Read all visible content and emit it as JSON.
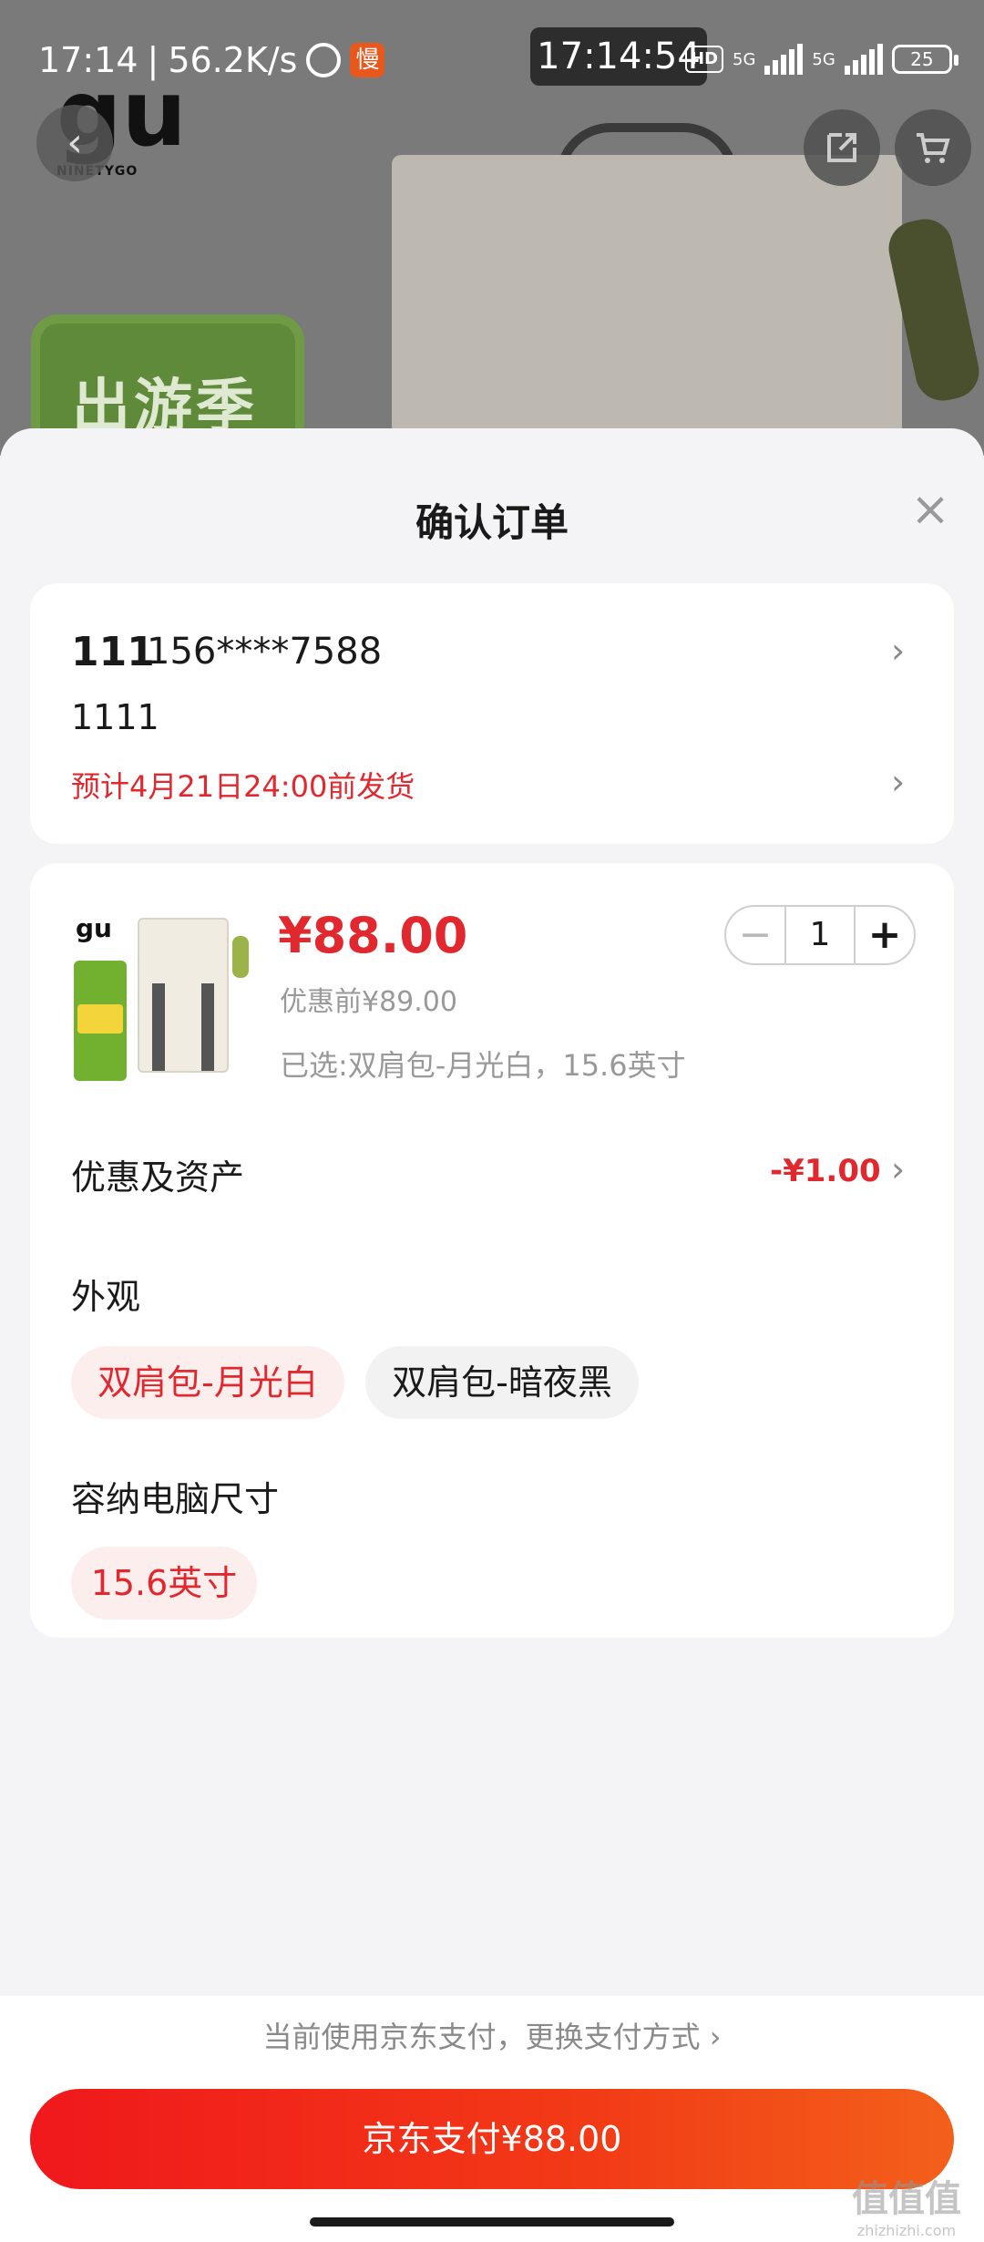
{
  "status_bar": {
    "time": "17:14",
    "speed": "56.2K/s",
    "slow_badge": "慢",
    "center_time": "17:14:54",
    "hd": "HD",
    "net1": "5G",
    "net2": "5G",
    "battery": "25"
  },
  "background": {
    "brand_word": "NINETYGO",
    "badge_text": "出游季"
  },
  "sheet": {
    "title": "确认订单",
    "close": "×"
  },
  "address": {
    "name": "111",
    "phone": "156****7588",
    "detail": "1111",
    "ship_eta": "预计4月21日24:00前发货"
  },
  "product": {
    "price": "¥88.00",
    "original_price": "优惠前¥89.00",
    "selected": "已选:双肩包-月光白，15.6英寸",
    "quantity": "1",
    "minus": "−",
    "plus": "+"
  },
  "discounts": {
    "label": "优惠及资产",
    "value": "-¥1.00"
  },
  "appearance": {
    "label": "外观",
    "options": [
      "双肩包-月光白",
      "双肩包-暗夜黑"
    ]
  },
  "laptop_size": {
    "label": "容纳电脑尺寸",
    "options": [
      "15.6英寸"
    ]
  },
  "payment": {
    "tip": "当前使用京东支付，更换支付方式",
    "button": "京东支付¥88.00"
  },
  "watermark": {
    "main": "值值值",
    "sub": "zhizhizhi.com"
  },
  "colors": {
    "accent_red": "#e0282e",
    "pay_gradient_start": "#f0181c",
    "pay_gradient_end": "#f3601a"
  }
}
